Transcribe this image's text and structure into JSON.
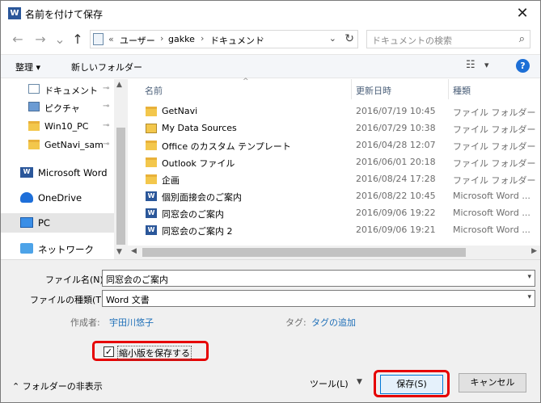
{
  "title_bar": {
    "app_icon_letter": "W",
    "title": "名前を付けて保存",
    "close_glyph": "✕"
  },
  "address_bar": {
    "back_glyph": "←",
    "forward_glyph": "→",
    "up_glyph": "↑",
    "overflow": "«",
    "segments": [
      "ユーザー",
      "gakke",
      "ドキュメント"
    ],
    "separator": "›",
    "dropdown_glyph": "⌄",
    "refresh_glyph": "↻"
  },
  "search": {
    "placeholder": "ドキュメントの検索",
    "icon": "search-icon"
  },
  "toolbar": {
    "organize": "整理 ▾",
    "new_folder": "新しいフォルダー",
    "view_glyph": "☷",
    "view_dropdown": "▾",
    "help": "?"
  },
  "nav_pane": {
    "quick_access": [
      {
        "label": "ドキュメント",
        "icon": "document-icon",
        "pinned": true
      },
      {
        "label": "ピクチャ",
        "icon": "picture-icon",
        "pinned": true
      },
      {
        "label": "Win10_PC",
        "icon": "folder-icon",
        "pinned": true
      },
      {
        "label": "GetNavi_sample",
        "icon": "folder-icon",
        "pinned": true
      }
    ],
    "pin_glyph": "📌",
    "locations": [
      {
        "label": "Microsoft Word",
        "icon": "word-icon"
      },
      {
        "label": "OneDrive",
        "icon": "cloud-icon"
      },
      {
        "label": "PC",
        "icon": "pc-icon",
        "selected": true
      },
      {
        "label": "ネットワーク",
        "icon": "network-icon"
      }
    ]
  },
  "file_list": {
    "columns": {
      "name": "名前",
      "date": "更新日時",
      "type": "種類"
    },
    "sort_glyph": "^",
    "rows": [
      {
        "name": "GetNavi",
        "date": "2016/07/19 10:45",
        "type": "ファイル フォルダー",
        "icon": "folder-icon"
      },
      {
        "name": "My Data Sources",
        "date": "2016/07/29 10:38",
        "type": "ファイル フォルダー",
        "icon": "data-sources-folder-icon"
      },
      {
        "name": "Office のカスタム テンプレート",
        "date": "2016/04/28 12:07",
        "type": "ファイル フォルダー",
        "icon": "folder-icon"
      },
      {
        "name": "Outlook ファイル",
        "date": "2016/06/01 20:18",
        "type": "ファイル フォルダー",
        "icon": "folder-icon"
      },
      {
        "name": "企画",
        "date": "2016/08/24 17:28",
        "type": "ファイル フォルダー",
        "icon": "folder-icon"
      },
      {
        "name": "個別面接会のご案内",
        "date": "2016/08/22 10:45",
        "type": "Microsoft Word ...",
        "icon": "word-doc-icon"
      },
      {
        "name": "同窓会のご案内",
        "date": "2016/09/06 19:22",
        "type": "Microsoft Word ...",
        "icon": "word-doc-icon"
      },
      {
        "name": "同窓会のご案内 2",
        "date": "2016/09/06 19:21",
        "type": "Microsoft Word ...",
        "icon": "word-doc-icon"
      }
    ]
  },
  "form": {
    "filename_label": "ファイル名(N):",
    "filename_value": "同窓会のご案内",
    "filetype_label": "ファイルの種類(T):",
    "filetype_value": "Word 文書",
    "author_label": "作成者:",
    "author_value": "宇田川悠子",
    "tags_label": "タグ:",
    "tags_value": "タグの追加",
    "thumbnail_label": "縮小版を保存する",
    "thumbnail_checked": "✓",
    "hide_folders": "フォルダーの非表示",
    "hide_glyph": "⌃",
    "tools": "ツール(L)",
    "tools_dropdown": "▼",
    "save": "保存(S)",
    "cancel": "キャンセル"
  },
  "scroll": {
    "up": "▲",
    "down": "▼",
    "left": "◀",
    "right": "▶"
  }
}
